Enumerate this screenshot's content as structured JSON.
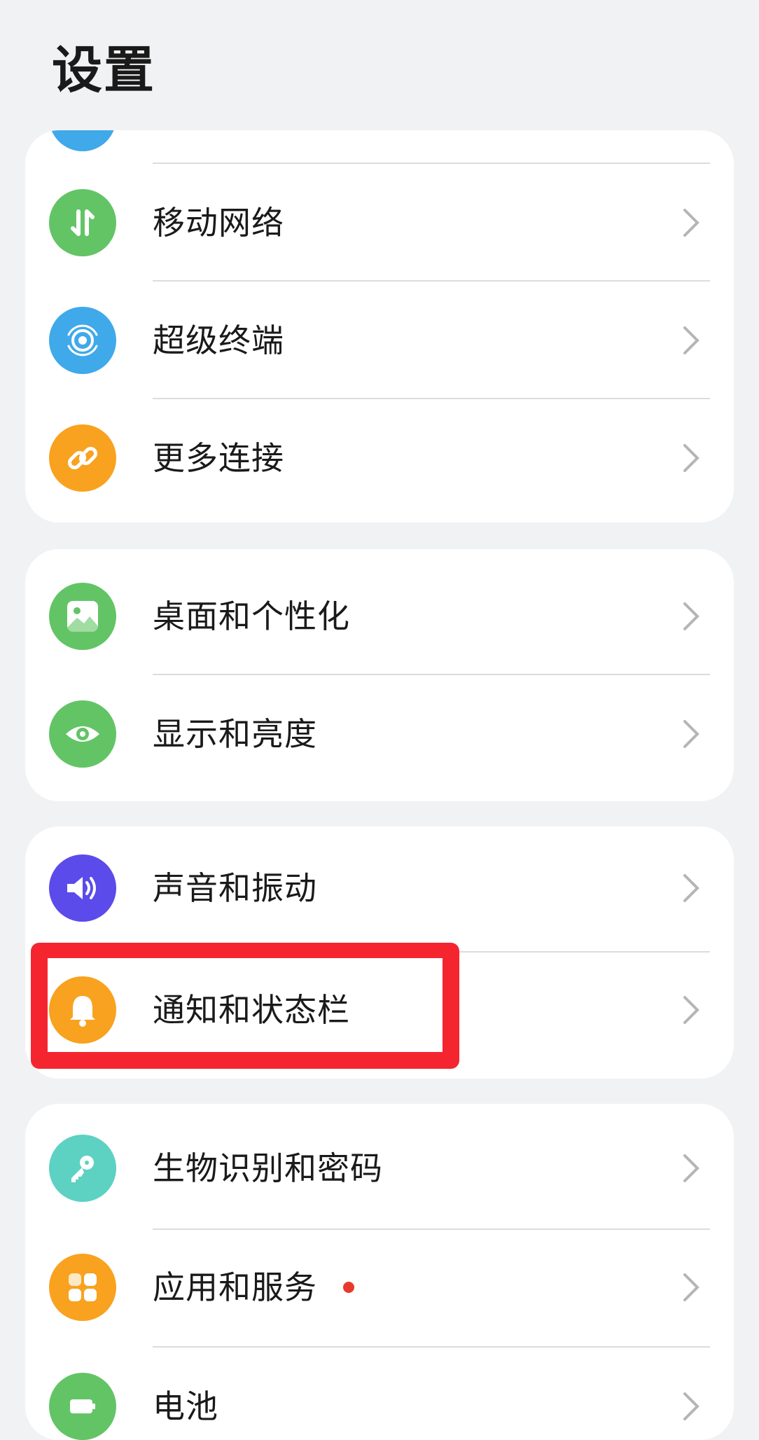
{
  "header": {
    "title": "设置"
  },
  "colors": {
    "green": "#63c466",
    "blue": "#3fa9ea",
    "orange": "#f8a21f",
    "purple": "#5a4bea",
    "teal": "#5dd1c2",
    "highlight": "#f5252f",
    "badge": "#e8392b"
  },
  "groups": [
    {
      "items": [
        {
          "label": "移动网络",
          "icon": "mobile-data-icon"
        },
        {
          "label": "超级终端",
          "icon": "super-device-icon"
        },
        {
          "label": "更多连接",
          "icon": "link-icon"
        }
      ]
    },
    {
      "items": [
        {
          "label": "桌面和个性化",
          "icon": "wallpaper-icon"
        },
        {
          "label": "显示和亮度",
          "icon": "eye-icon"
        }
      ]
    },
    {
      "items": [
        {
          "label": "声音和振动",
          "icon": "speaker-icon"
        },
        {
          "label": "通知和状态栏",
          "icon": "bell-icon",
          "highlighted": true
        }
      ]
    },
    {
      "items": [
        {
          "label": "生物识别和密码",
          "icon": "key-icon"
        },
        {
          "label": "应用和服务",
          "icon": "apps-icon",
          "badge": "new-dot"
        },
        {
          "label": "电池",
          "icon": "battery-icon"
        }
      ]
    }
  ]
}
